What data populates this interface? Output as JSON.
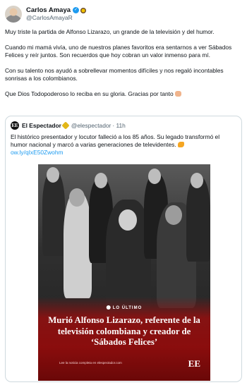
{
  "author": {
    "name": "Carlos Amaya",
    "handle": "@CarlosAmayaR"
  },
  "tweet": {
    "paragraphs": [
      "Muy triste la partida de Alfonso Lizarazo, un grande de la televisión y del humor.",
      "Cuando mi mamá vivía, uno de nuestros planes favoritos era sentarnos a ver Sábados Felices y reír juntos. Son recuerdos que hoy cobran un valor inmenso para mí.",
      "Con su talento nos ayudó a sobrellevar momentos difíciles y nos regaló incontables sonrisas a los colombianos.",
      "Que Dios Todopoderoso lo reciba en su gloria. Gracias por tanto"
    ]
  },
  "quote": {
    "logo": "EE",
    "name": "El Espectador",
    "handle": "@elespectador",
    "time": "· 11h",
    "text": "El histórico presentador y locutor falleció a los 85 años. Su legado transformó el humor nacional y marcó a varias generaciones de televidentes.",
    "link": "ow.ly/qIxE50Zwohm",
    "image": {
      "badge": "LO ÚLTIMO",
      "headline": "Murió Alfonso Lizarazo, referente de la televisión colombiana y creador de ‘Sábados Felices’",
      "footer": "Lee la noticia completa en elespectador.com",
      "brand": "EE"
    }
  },
  "colors": {
    "accent": "#1d9bf0",
    "text": "#0f1419",
    "muted": "#536471",
    "news_red": "#8a0d0d"
  },
  "icons": [
    "verified-icon",
    "flag-icon",
    "praying-hands-icon",
    "point-right-icon"
  ]
}
